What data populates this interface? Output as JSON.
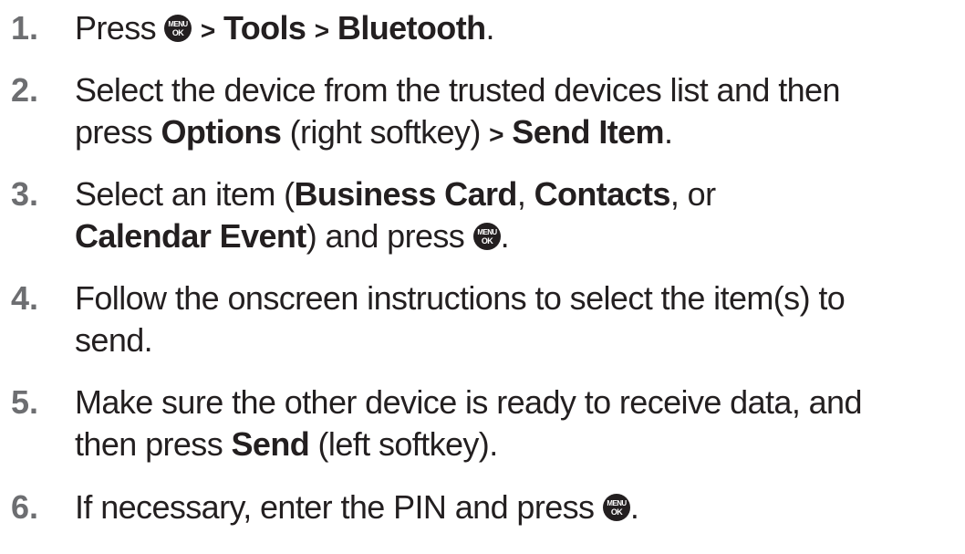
{
  "icons": {
    "menu_ok_key": "menu-ok-key-icon"
  },
  "steps": [
    {
      "number": "1.",
      "press": "Press",
      "sep1": ">",
      "tools": "Tools",
      "sep2": ">",
      "bluetooth": "Bluetooth",
      "end": "."
    },
    {
      "number": "2.",
      "line1": "Select the device from the trusted devices list and then",
      "press": "press",
      "options": "Options",
      "middle": "(right softkey)",
      "sep": ">",
      "send_item": "Send Item",
      "end": "."
    },
    {
      "number": "3.",
      "intro": "Select an item (",
      "business_card": "Business Card",
      "comma1": ",",
      "contacts": "Contacts",
      "or": ", or",
      "calendar_event": "Calendar Event",
      "and_press": ") and press",
      "end": "."
    },
    {
      "number": "4.",
      "line1": "Follow the onscreen instructions to select the item(s) to",
      "line2": "send."
    },
    {
      "number": "5.",
      "line1": "Make sure the other device is ready to receive data, and",
      "then_press": "then press",
      "send": "Send",
      "rest": "(left softkey)."
    },
    {
      "number": "6.",
      "text": "If necessary, enter the PIN and press",
      "end": "."
    }
  ]
}
